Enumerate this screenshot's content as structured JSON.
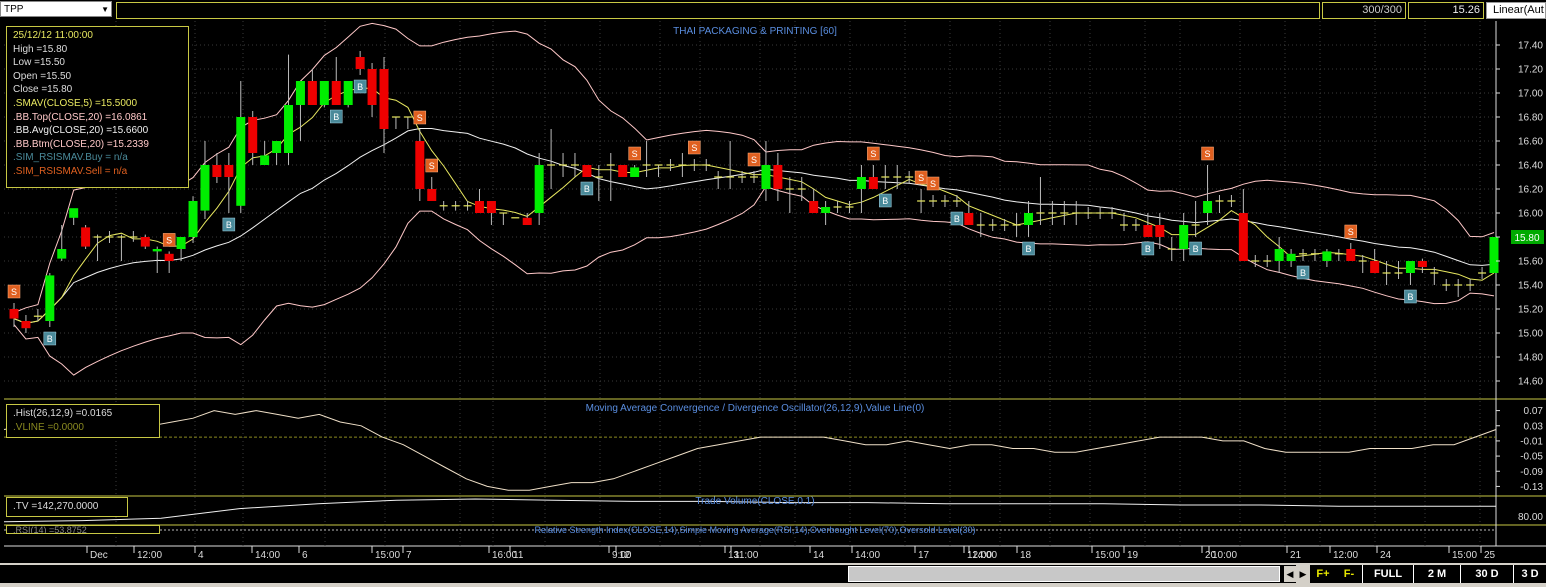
{
  "toolbar": {
    "symbol": "TPP",
    "bars_count": "300/300",
    "last_price": "15.26",
    "scale_mode": "Linear(Aut"
  },
  "ohlc_box": {
    "datetime": "25/12/12 11:00:00",
    "high": "High  =15.80",
    "low": "Low   =15.50",
    "open": "Open  =15.50",
    "close": "Close  =15.80",
    "smav": ".SMAV(CLOSE,5)   =15.5000",
    "bb_top": ".BB.Top(CLOSE,20)   =16.0861",
    "bb_avg": ".BB.Avg(CLOSE,20)    =15.6600",
    "bb_btm": ".BB.Btm(CLOSE,20)    =15.2339",
    "sim_buy": ".SIM_RSISMAV.Buy    = n/a",
    "sim_sell": ".SIM_RSISMAV.Sell    = n/a"
  },
  "macd_box": {
    "hist": ".Hist(26,12,9)    =0.0165",
    "vline": ".VLINE    =0.0000"
  },
  "volume_box": {
    "tv": ".TV    =142,270.0000"
  },
  "rsi_box": {
    "rsi": ".RSI(14)    =53.8752"
  },
  "footer": {
    "f_plus": "F+",
    "f_minus": "F-",
    "full": "FULL",
    "two_m": "2 M",
    "thirty_d": "30 D",
    "three_d": "3 D"
  },
  "colors": {
    "up": "#00ee00",
    "down": "#ee0000",
    "sma": "#e8e860",
    "bb": "#ffc8c8",
    "signal_sell": "#e06020",
    "signal_buy": "#4a8a9a",
    "panel_border": "#c8c844",
    "title_blue": "#5a8ee0"
  },
  "chart_data": [
    {
      "type": "candlestick",
      "title": "THAI PACKAGING & PRINTING [60]",
      "ylim": [
        14.45,
        17.55
      ],
      "y_ticks": [
        "17.40",
        "17.20",
        "17.00",
        "16.80",
        "16.60",
        "16.40",
        "16.20",
        "16.00",
        "15.80",
        "15.60",
        "15.40",
        "15.20",
        "15.00",
        "14.80",
        "14.60"
      ],
      "last_price_label": "15.80",
      "x_labels": [
        "Dec",
        "12:00",
        "4",
        "14:00",
        "6",
        "15:00",
        "7",
        "16:00",
        "11",
        "9:00",
        "12",
        "11:00",
        "13",
        "14:00",
        "14",
        "12:00",
        "17",
        "14:00",
        "18",
        "15:00",
        "19",
        "10:00",
        "20",
        "21",
        "12:00",
        "24",
        "15:00",
        "25"
      ],
      "candles": [
        {
          "o": 15.2,
          "h": 15.25,
          "l": 15.05,
          "c": 15.12
        },
        {
          "o": 15.1,
          "h": 15.15,
          "l": 15.0,
          "c": 15.04
        },
        {
          "o": 15.14,
          "h": 15.2,
          "l": 15.1,
          "c": 15.14
        },
        {
          "o": 15.1,
          "h": 15.5,
          "l": 15.05,
          "c": 15.48
        },
        {
          "o": 15.62,
          "h": 15.9,
          "l": 15.6,
          "c": 15.7
        },
        {
          "o": 15.96,
          "h": 16.0,
          "l": 15.9,
          "c": 16.04
        },
        {
          "o": 15.88,
          "h": 15.9,
          "l": 15.7,
          "c": 15.72
        },
        {
          "o": 15.8,
          "h": 15.82,
          "l": 15.6,
          "c": 15.8
        },
        {
          "o": 15.8,
          "h": 15.85,
          "l": 15.75,
          "c": 15.8
        },
        {
          "o": 15.8,
          "h": 15.82,
          "l": 15.6,
          "c": 15.8
        },
        {
          "o": 15.8,
          "h": 15.85,
          "l": 15.76,
          "c": 15.8
        },
        {
          "o": 15.8,
          "h": 15.82,
          "l": 15.7,
          "c": 15.72
        },
        {
          "o": 15.68,
          "h": 15.72,
          "l": 15.5,
          "c": 15.7
        },
        {
          "o": 15.66,
          "h": 15.68,
          "l": 15.5,
          "c": 15.6
        },
        {
          "o": 15.7,
          "h": 15.72,
          "l": 15.6,
          "c": 15.8
        },
        {
          "o": 15.8,
          "h": 16.14,
          "l": 15.75,
          "c": 16.1
        },
        {
          "o": 16.02,
          "h": 16.6,
          "l": 15.95,
          "c": 16.4
        },
        {
          "o": 16.4,
          "h": 16.5,
          "l": 16.25,
          "c": 16.3
        },
        {
          "o": 16.4,
          "h": 16.5,
          "l": 16.0,
          "c": 16.3
        },
        {
          "o": 16.06,
          "h": 17.1,
          "l": 16.0,
          "c": 16.8
        },
        {
          "o": 16.8,
          "h": 16.85,
          "l": 16.4,
          "c": 16.5
        },
        {
          "o": 16.4,
          "h": 16.6,
          "l": 16.4,
          "c": 16.48
        },
        {
          "o": 16.5,
          "h": 16.6,
          "l": 16.4,
          "c": 16.6
        },
        {
          "o": 16.5,
          "h": 17.32,
          "l": 16.4,
          "c": 16.9
        },
        {
          "o": 16.9,
          "h": 17.05,
          "l": 16.6,
          "c": 17.1
        },
        {
          "o": 17.1,
          "h": 17.2,
          "l": 16.9,
          "c": 16.9
        },
        {
          "o": 16.9,
          "h": 17.1,
          "l": 16.88,
          "c": 17.1
        },
        {
          "o": 17.1,
          "h": 17.3,
          "l": 16.9,
          "c": 16.9
        },
        {
          "o": 16.9,
          "h": 17.1,
          "l": 16.88,
          "c": 17.1
        },
        {
          "o": 17.3,
          "h": 17.35,
          "l": 17.15,
          "c": 17.2
        },
        {
          "o": 17.2,
          "h": 17.25,
          "l": 16.8,
          "c": 16.9
        },
        {
          "o": 17.2,
          "h": 17.3,
          "l": 16.5,
          "c": 16.7
        },
        {
          "o": 16.8,
          "h": 16.8,
          "l": 16.7,
          "c": 16.8
        },
        {
          "o": 16.8,
          "h": 16.8,
          "l": 16.7,
          "c": 16.8
        },
        {
          "o": 16.6,
          "h": 16.7,
          "l": 16.1,
          "c": 16.2
        },
        {
          "o": 16.2,
          "h": 16.3,
          "l": 16.1,
          "c": 16.1
        },
        {
          "o": 16.06,
          "h": 16.1,
          "l": 16.02,
          "c": 16.06
        },
        {
          "o": 16.06,
          "h": 16.1,
          "l": 16.02,
          "c": 16.06
        },
        {
          "o": 16.06,
          "h": 16.1,
          "l": 16.02,
          "c": 16.06
        },
        {
          "o": 16.1,
          "h": 16.2,
          "l": 16.0,
          "c": 16.0
        },
        {
          "o": 16.1,
          "h": 16.1,
          "l": 15.9,
          "c": 16.0
        },
        {
          "o": 16.0,
          "h": 16.0,
          "l": 15.9,
          "c": 16.0
        },
        {
          "o": 15.96,
          "h": 15.96,
          "l": 15.96,
          "c": 15.96
        },
        {
          "o": 15.96,
          "h": 16.0,
          "l": 15.9,
          "c": 15.9
        },
        {
          "o": 16.0,
          "h": 16.5,
          "l": 15.9,
          "c": 16.4
        },
        {
          "o": 16.4,
          "h": 16.7,
          "l": 16.2,
          "c": 16.4
        },
        {
          "o": 16.4,
          "h": 16.5,
          "l": 16.3,
          "c": 16.4
        },
        {
          "o": 16.4,
          "h": 16.5,
          "l": 16.3,
          "c": 16.4
        },
        {
          "o": 16.4,
          "h": 16.4,
          "l": 16.3,
          "c": 16.3
        },
        {
          "o": 16.3,
          "h": 16.4,
          "l": 16.1,
          "c": 16.3
        },
        {
          "o": 16.4,
          "h": 16.5,
          "l": 16.1,
          "c": 16.4
        },
        {
          "o": 16.4,
          "h": 16.4,
          "l": 16.3,
          "c": 16.3
        },
        {
          "o": 16.3,
          "h": 16.4,
          "l": 16.3,
          "c": 16.38
        },
        {
          "o": 16.4,
          "h": 16.6,
          "l": 16.3,
          "c": 16.4
        },
        {
          "o": 16.4,
          "h": 16.4,
          "l": 16.3,
          "c": 16.4
        },
        {
          "o": 16.4,
          "h": 16.45,
          "l": 16.35,
          "c": 16.4
        },
        {
          "o": 16.4,
          "h": 16.5,
          "l": 16.3,
          "c": 16.4
        },
        {
          "o": 16.4,
          "h": 16.45,
          "l": 16.35,
          "c": 16.4
        },
        {
          "o": 16.4,
          "h": 16.45,
          "l": 16.35,
          "c": 16.4
        },
        {
          "o": 16.3,
          "h": 16.35,
          "l": 16.2,
          "c": 16.3
        },
        {
          "o": 16.3,
          "h": 16.6,
          "l": 16.2,
          "c": 16.3
        },
        {
          "o": 16.3,
          "h": 16.35,
          "l": 16.25,
          "c": 16.3
        },
        {
          "o": 16.3,
          "h": 16.35,
          "l": 16.25,
          "c": 16.3
        },
        {
          "o": 16.2,
          "h": 16.6,
          "l": 16.1,
          "c": 16.4
        },
        {
          "o": 16.4,
          "h": 16.5,
          "l": 16.1,
          "c": 16.2
        },
        {
          "o": 16.2,
          "h": 16.3,
          "l": 16.0,
          "c": 16.2
        },
        {
          "o": 16.2,
          "h": 16.3,
          "l": 16.1,
          "c": 16.2
        },
        {
          "o": 16.1,
          "h": 16.2,
          "l": 16.0,
          "c": 16.0
        },
        {
          "o": 16.0,
          "h": 16.1,
          "l": 15.9,
          "c": 16.05
        },
        {
          "o": 16.05,
          "h": 16.1,
          "l": 16.0,
          "c": 16.05
        },
        {
          "o": 16.05,
          "h": 16.1,
          "l": 16.0,
          "c": 16.05
        },
        {
          "o": 16.2,
          "h": 16.4,
          "l": 16.0,
          "c": 16.3
        },
        {
          "o": 16.3,
          "h": 16.4,
          "l": 16.2,
          "c": 16.2
        },
        {
          "o": 16.3,
          "h": 16.4,
          "l": 16.2,
          "c": 16.3
        },
        {
          "o": 16.3,
          "h": 16.4,
          "l": 16.2,
          "c": 16.3
        },
        {
          "o": 16.3,
          "h": 16.35,
          "l": 16.25,
          "c": 16.3
        },
        {
          "o": 16.1,
          "h": 16.2,
          "l": 16.0,
          "c": 16.1
        },
        {
          "o": 16.1,
          "h": 16.15,
          "l": 16.05,
          "c": 16.1
        },
        {
          "o": 16.1,
          "h": 16.15,
          "l": 16.05,
          "c": 16.1
        },
        {
          "o": 16.1,
          "h": 16.15,
          "l": 16.05,
          "c": 16.1
        },
        {
          "o": 16.0,
          "h": 16.1,
          "l": 15.9,
          "c": 15.9
        },
        {
          "o": 15.9,
          "h": 16.0,
          "l": 15.8,
          "c": 15.9
        },
        {
          "o": 15.9,
          "h": 15.95,
          "l": 15.85,
          "c": 15.9
        },
        {
          "o": 15.9,
          "h": 15.95,
          "l": 15.85,
          "c": 15.9
        },
        {
          "o": 15.9,
          "h": 16.0,
          "l": 15.8,
          "c": 15.9
        },
        {
          "o": 15.9,
          "h": 16.1,
          "l": 15.8,
          "c": 16.0
        },
        {
          "o": 16.0,
          "h": 16.3,
          "l": 15.9,
          "c": 16.0
        },
        {
          "o": 16.0,
          "h": 16.1,
          "l": 15.9,
          "c": 16.0
        },
        {
          "o": 16.0,
          "h": 16.1,
          "l": 15.9,
          "c": 16.0
        },
        {
          "o": 16.0,
          "h": 16.1,
          "l": 15.9,
          "c": 16.0
        },
        {
          "o": 16.0,
          "h": 16.05,
          "l": 15.95,
          "c": 16.0
        },
        {
          "o": 16.0,
          "h": 16.05,
          "l": 15.95,
          "c": 16.0
        },
        {
          "o": 16.0,
          "h": 16.05,
          "l": 15.95,
          "c": 16.0
        },
        {
          "o": 15.9,
          "h": 16.0,
          "l": 15.85,
          "c": 15.9
        },
        {
          "o": 15.9,
          "h": 15.95,
          "l": 15.85,
          "c": 15.9
        },
        {
          "o": 15.9,
          "h": 16.0,
          "l": 15.8,
          "c": 15.8
        },
        {
          "o": 15.9,
          "h": 16.0,
          "l": 15.7,
          "c": 15.8
        },
        {
          "o": 15.7,
          "h": 15.8,
          "l": 15.6,
          "c": 15.7
        },
        {
          "o": 15.7,
          "h": 16.0,
          "l": 15.6,
          "c": 15.9
        },
        {
          "o": 15.9,
          "h": 16.1,
          "l": 15.8,
          "c": 15.9
        },
        {
          "o": 16.0,
          "h": 16.4,
          "l": 15.9,
          "c": 16.1
        },
        {
          "o": 16.1,
          "h": 16.15,
          "l": 16.0,
          "c": 16.1
        },
        {
          "o": 16.1,
          "h": 16.15,
          "l": 16.05,
          "c": 16.1
        },
        {
          "o": 16.0,
          "h": 16.2,
          "l": 15.6,
          "c": 15.6
        },
        {
          "o": 15.6,
          "h": 15.65,
          "l": 15.55,
          "c": 15.6
        },
        {
          "o": 15.6,
          "h": 15.65,
          "l": 15.55,
          "c": 15.6
        },
        {
          "o": 15.6,
          "h": 15.8,
          "l": 15.5,
          "c": 15.7
        },
        {
          "o": 15.6,
          "h": 15.7,
          "l": 15.55,
          "c": 15.66
        },
        {
          "o": 15.66,
          "h": 15.7,
          "l": 15.6,
          "c": 15.66
        },
        {
          "o": 15.66,
          "h": 15.7,
          "l": 15.6,
          "c": 15.66
        },
        {
          "o": 15.6,
          "h": 15.7,
          "l": 15.55,
          "c": 15.68
        },
        {
          "o": 15.66,
          "h": 15.7,
          "l": 15.6,
          "c": 15.66
        },
        {
          "o": 15.7,
          "h": 15.75,
          "l": 15.6,
          "c": 15.6
        },
        {
          "o": 15.6,
          "h": 15.65,
          "l": 15.5,
          "c": 15.6
        },
        {
          "o": 15.6,
          "h": 15.7,
          "l": 15.5,
          "c": 15.5
        },
        {
          "o": 15.5,
          "h": 15.6,
          "l": 15.4,
          "c": 15.5
        },
        {
          "o": 15.5,
          "h": 15.6,
          "l": 15.45,
          "c": 15.5
        },
        {
          "o": 15.5,
          "h": 15.6,
          "l": 15.4,
          "c": 15.6
        },
        {
          "o": 15.6,
          "h": 15.62,
          "l": 15.5,
          "c": 15.55
        },
        {
          "o": 15.5,
          "h": 15.55,
          "l": 15.4,
          "c": 15.5
        },
        {
          "o": 15.4,
          "h": 15.45,
          "l": 15.35,
          "c": 15.4
        },
        {
          "o": 15.4,
          "h": 15.45,
          "l": 15.3,
          "c": 15.4
        },
        {
          "o": 15.4,
          "h": 15.45,
          "l": 15.35,
          "c": 15.4
        },
        {
          "o": 15.5,
          "h": 15.55,
          "l": 15.45,
          "c": 15.5
        },
        {
          "o": 15.5,
          "h": 15.8,
          "l": 15.5,
          "c": 15.8
        }
      ]
    },
    {
      "type": "line",
      "title": "Moving Average Convergence / Divergence Oscillator(26,12,9),Value Line(0)",
      "y_ticks": [
        "0.07",
        "0.03",
        "-0.01",
        "-0.05",
        "-0.09",
        "-0.13"
      ],
      "series": [
        {
          "name": ".Hist(26,12,9)",
          "values": [
            0.02,
            0.03,
            0.04,
            0.03,
            0.02,
            0.01,
            0.01,
            0.03,
            0.04,
            0.05,
            0.07,
            0.06,
            0.07,
            0.06,
            0.05,
            0.06,
            0.04,
            0.03,
            0.0,
            -0.02,
            -0.05,
            -0.08,
            -0.11,
            -0.13,
            -0.14,
            -0.14,
            -0.13,
            -0.12,
            -0.12,
            -0.11,
            -0.09,
            -0.07,
            -0.05,
            -0.03,
            -0.02,
            -0.01,
            0.0,
            0.0,
            0.0,
            0.0,
            -0.01,
            -0.02,
            -0.02,
            -0.01,
            -0.02,
            -0.03,
            -0.02,
            -0.02,
            -0.03,
            -0.03,
            -0.04,
            -0.04,
            -0.03,
            -0.02,
            -0.01,
            0.0,
            0.0,
            0.0,
            -0.01,
            -0.01,
            -0.03,
            -0.04,
            -0.04,
            -0.04,
            -0.04,
            -0.03,
            -0.03,
            -0.03,
            -0.02,
            -0.02,
            0.0,
            0.02
          ]
        },
        {
          "name": ".VLINE",
          "values": [
            0,
            0
          ]
        }
      ]
    },
    {
      "type": "line",
      "title": "Trade Volume(CLOSE,0.1)",
      "y_ticks": [],
      "series": [
        {
          "name": ".TV",
          "values": [
            0.05,
            0.1,
            0.2,
            0.6,
            0.8,
            0.95,
            1.0,
            0.95,
            0.9,
            0.9,
            0.85,
            0.85,
            0.8,
            0.8,
            0.8,
            0.75,
            0.75,
            0.7,
            0.7,
            0.7
          ]
        }
      ]
    },
    {
      "type": "line",
      "title": "Relative Strength Index(CLOSE,14),Simple Moving Average(RSI,14),Overbought Level(70),Oversold Level(30)",
      "y_ticks": [
        "80.00"
      ],
      "series": [
        {
          "name": ".RSI(14)",
          "values": [
            53.88
          ]
        }
      ]
    }
  ]
}
